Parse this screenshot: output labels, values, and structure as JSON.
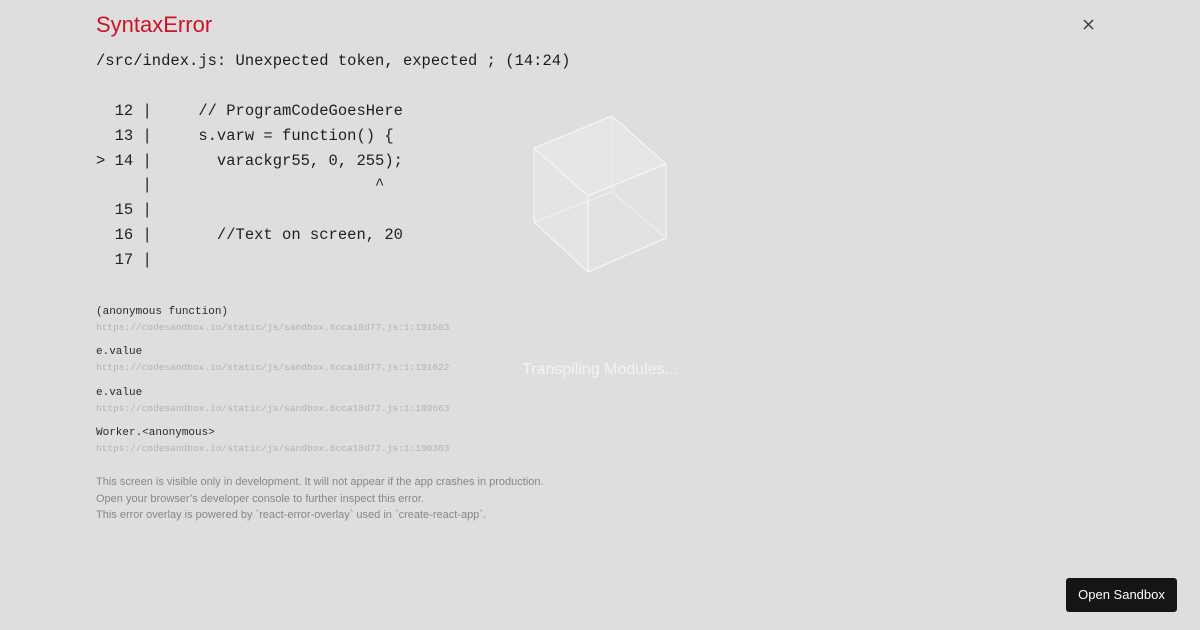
{
  "error": {
    "title": "SyntaxError",
    "message": "/src/index.js: Unexpected token, expected ; (14:24)",
    "close_icon": "close-icon",
    "title_color": "#ce1126"
  },
  "code_frame": [
    "  12 |     // ProgramCodeGoesHere",
    "  13 |     s.varw = function() {",
    "> 14 |       varackgr55, 0, 255);",
    "     |                        ^",
    "  15 |",
    "  16 |       //Text on screen, 20",
    "  17 |"
  ],
  "stack_frames": [
    {
      "fn": "(anonymous function)",
      "location": "https://codesandbox.io/static/js/sandbox.6cca18d77.js:1:191503"
    },
    {
      "fn": "e.value",
      "location": "https://codesandbox.io/static/js/sandbox.6cca18d77.js:1:191622"
    },
    {
      "fn": "e.value",
      "location": "https://codesandbox.io/static/js/sandbox.6cca18d77.js:1:189663"
    },
    {
      "fn": "Worker.<anonymous>",
      "location": "https://codesandbox.io/static/js/sandbox.6cca18d77.js:1:190383"
    }
  ],
  "footer_notes": [
    "This screen is visible only in development. It will not appear if the app crashes in production.",
    "Open your browser’s developer console to further inspect this error.",
    "This error overlay is powered by `react-error-overlay` used in `create-react-app`."
  ],
  "loader": {
    "icon": "cube-icon",
    "text": "Transpiling Modules..."
  },
  "actions": {
    "open_sandbox_label": "Open Sandbox"
  }
}
